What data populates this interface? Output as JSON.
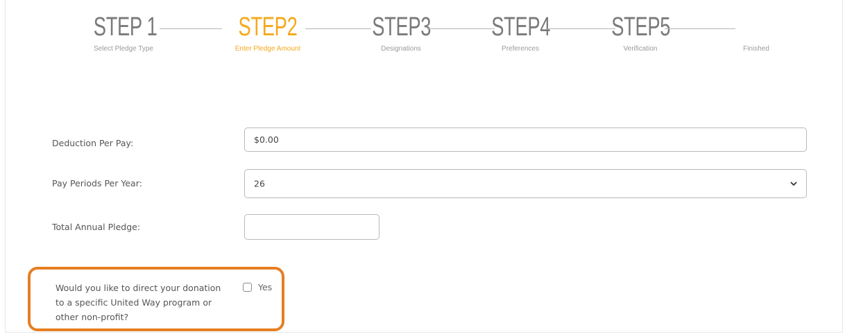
{
  "stepper": {
    "steps": [
      {
        "title": "STEP 1",
        "label": "Select Pledge Type",
        "active": false
      },
      {
        "title": "STEP2",
        "label": "Enter Pledge Amount",
        "active": true
      },
      {
        "title": "STEP3",
        "label": "Designations",
        "active": false
      },
      {
        "title": "STEP4",
        "label": "Preferences",
        "active": false
      },
      {
        "title": "STEP5",
        "label": "Verification",
        "active": false
      },
      {
        "title": "",
        "label": "Finished",
        "active": false
      }
    ]
  },
  "form": {
    "deduction": {
      "label": "Deduction Per Pay:",
      "value": "$0.00"
    },
    "pay_periods": {
      "label": "Pay Periods Per Year:",
      "selected": "26"
    },
    "total": {
      "label": "Total Annual Pledge:",
      "value": ""
    },
    "designate": {
      "question": "Would you like to direct your donation to a specific United Way program or other non-profit?",
      "option_label": "Yes",
      "checked": false
    }
  },
  "colors": {
    "accent": "#f5a81c",
    "callout_border": "#e67e22",
    "inactive_step": "#7a7a7a"
  },
  "icons": {
    "select_arrow": "chevron-down-icon"
  }
}
